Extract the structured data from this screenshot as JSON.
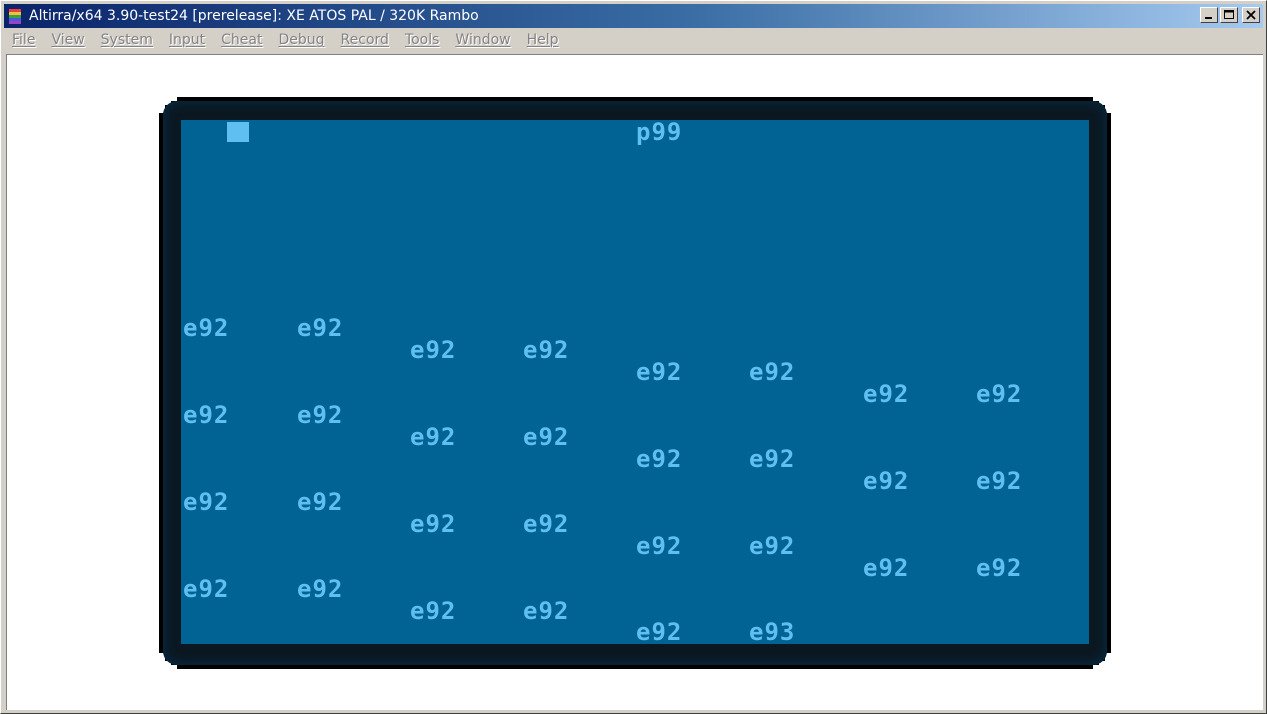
{
  "window": {
    "title": "Altirra/x64 3.90-test24 [prerelease]: XE ATOS PAL / 320K Rambo",
    "icon": "altirra-app-icon",
    "buttons": {
      "minimize": "minimize-icon",
      "maximize": "maximize-icon",
      "close": "close-icon"
    }
  },
  "menubar": {
    "items": [
      {
        "label": "File"
      },
      {
        "label": "View"
      },
      {
        "label": "System"
      },
      {
        "label": "Input"
      },
      {
        "label": "Cheat"
      },
      {
        "label": "Debug"
      },
      {
        "label": "Record"
      },
      {
        "label": "Tools"
      },
      {
        "label": "Window"
      },
      {
        "label": "Help"
      }
    ]
  },
  "screen": {
    "colors": {
      "background": "#016393",
      "foreground": "#5ebff0",
      "border": "#000000"
    },
    "header": "p99",
    "rows": [
      [
        "e92",
        "e92",
        "e92",
        "e92",
        "e92",
        "e92",
        "e92",
        "e92"
      ],
      [
        "e92",
        "e92",
        "e92",
        "e92",
        "e92",
        "e92",
        "e92",
        "e92"
      ],
      [
        "e92",
        "e92",
        "e92",
        "e92",
        "e92",
        "e92",
        "e92",
        "e92"
      ],
      [
        "e92",
        "e92",
        "e92",
        "e92",
        "e92",
        "e93"
      ]
    ]
  }
}
